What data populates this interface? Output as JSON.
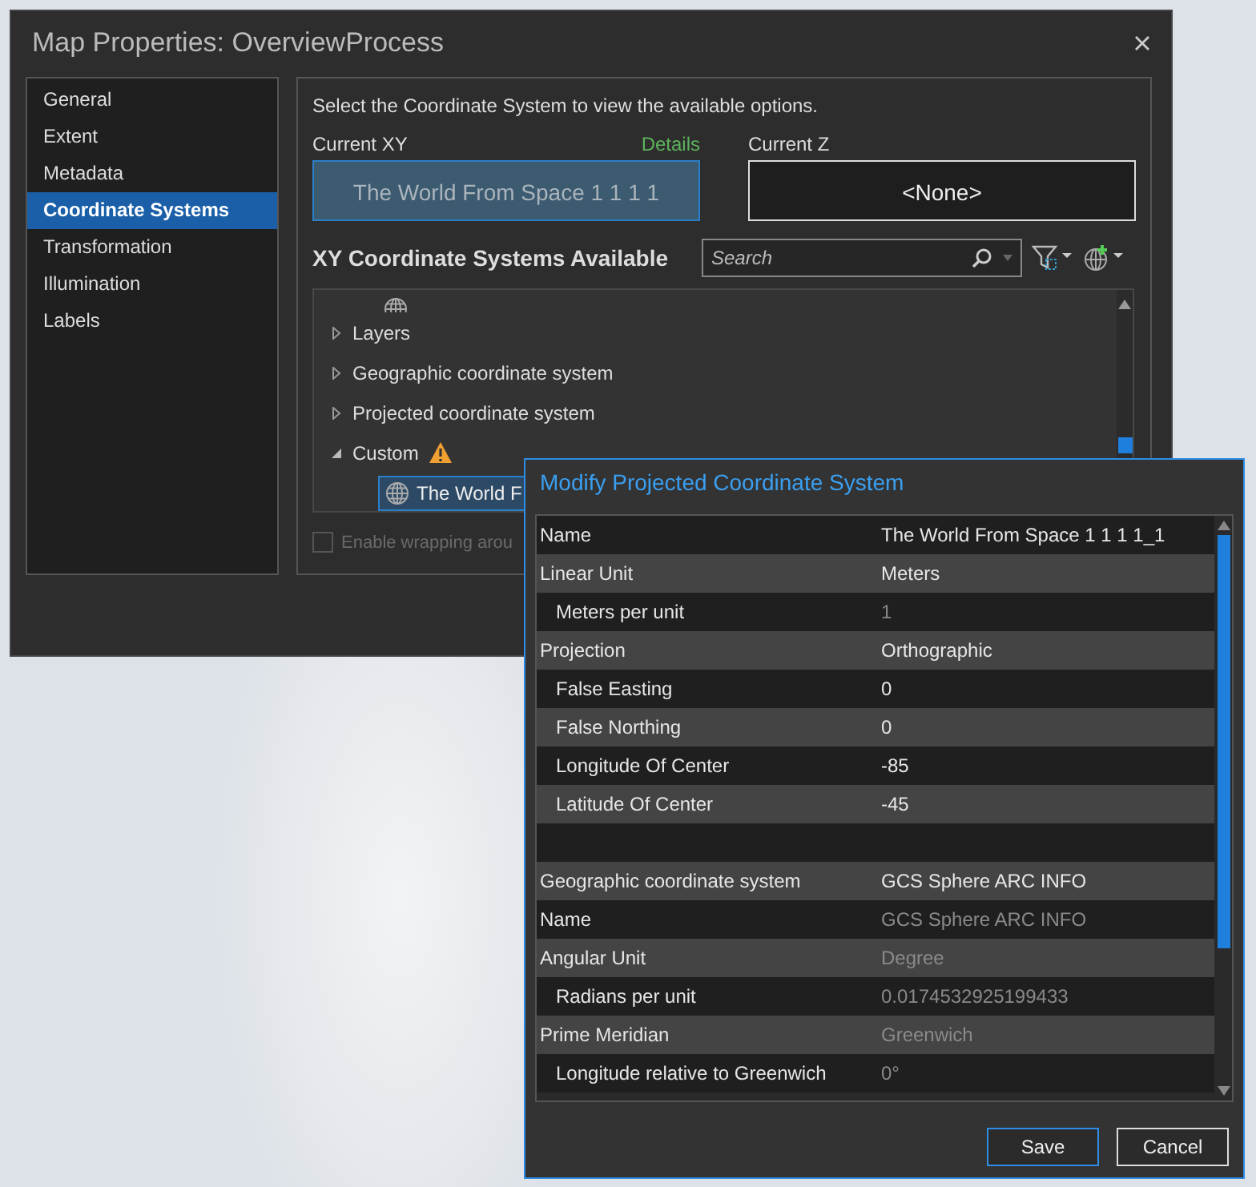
{
  "window": {
    "title": "Map Properties: OverviewProcess"
  },
  "sidebar": {
    "items": [
      {
        "label": "General",
        "selected": false
      },
      {
        "label": "Extent",
        "selected": false
      },
      {
        "label": "Metadata",
        "selected": false
      },
      {
        "label": "Coordinate Systems",
        "selected": true
      },
      {
        "label": "Transformation",
        "selected": false
      },
      {
        "label": "Illumination",
        "selected": false
      },
      {
        "label": "Labels",
        "selected": false
      }
    ]
  },
  "content": {
    "instruction": "Select the Coordinate System to view the available options.",
    "current_xy": {
      "label": "Current XY",
      "link": "Details",
      "value": "The World From Space 1 1 1 1"
    },
    "current_z": {
      "label": "Current Z",
      "value": "<None>"
    },
    "available": {
      "heading": "XY Coordinate Systems Available",
      "search": {
        "placeholder": "Search"
      },
      "tree": [
        {
          "label": "Layers",
          "expanded": false
        },
        {
          "label": "Geographic coordinate system",
          "expanded": false
        },
        {
          "label": "Projected coordinate system",
          "expanded": false
        },
        {
          "label": "Custom",
          "expanded": true,
          "warning": true,
          "children": [
            {
              "label": "The World F",
              "selected": true
            }
          ]
        }
      ]
    },
    "wrap_checkbox": {
      "label": "Enable wrapping arou",
      "checked": false,
      "disabled": true
    }
  },
  "modify_dialog": {
    "title": "Modify Projected Coordinate System",
    "rows": [
      {
        "kind": "property",
        "name": "Name",
        "value": "The World From Space 1 1 1 1_1",
        "disabled": false
      },
      {
        "kind": "property",
        "name": "Linear Unit",
        "value": "Meters",
        "disabled": false,
        "children": [
          {
            "kind": "property",
            "name": "Meters per unit",
            "value": "1",
            "disabled": true
          }
        ]
      },
      {
        "kind": "property",
        "name": "Projection",
        "value": "Orthographic",
        "disabled": false,
        "children": [
          {
            "kind": "property",
            "name": "False Easting",
            "value": "0",
            "disabled": false
          },
          {
            "kind": "property",
            "name": "False Northing",
            "value": "0",
            "disabled": false
          },
          {
            "kind": "property",
            "name": "Longitude Of Center",
            "value": "-85",
            "disabled": false
          },
          {
            "kind": "property",
            "name": "Latitude Of Center",
            "value": "-45",
            "disabled": false
          }
        ]
      },
      {
        "kind": "spacer"
      },
      {
        "kind": "property",
        "name": "Geographic coordinate system",
        "value": "GCS Sphere ARC INFO",
        "disabled": false
      },
      {
        "kind": "property",
        "name": "Name",
        "value": "GCS Sphere ARC INFO",
        "disabled": true
      },
      {
        "kind": "property",
        "name": "Angular Unit",
        "value": "Degree",
        "disabled": true,
        "children": [
          {
            "kind": "property",
            "name": "Radians per unit",
            "value": "0.0174532925199433",
            "disabled": true
          }
        ]
      },
      {
        "kind": "property",
        "name": "Prime Meridian",
        "value": "Greenwich",
        "disabled": true,
        "children": [
          {
            "kind": "property",
            "name": "Longitude relative to Greenwich",
            "value": "0°",
            "disabled": true
          }
        ]
      }
    ],
    "buttons": [
      {
        "label": "Save",
        "selected": true
      },
      {
        "label": "Cancel",
        "selected": false
      }
    ]
  }
}
